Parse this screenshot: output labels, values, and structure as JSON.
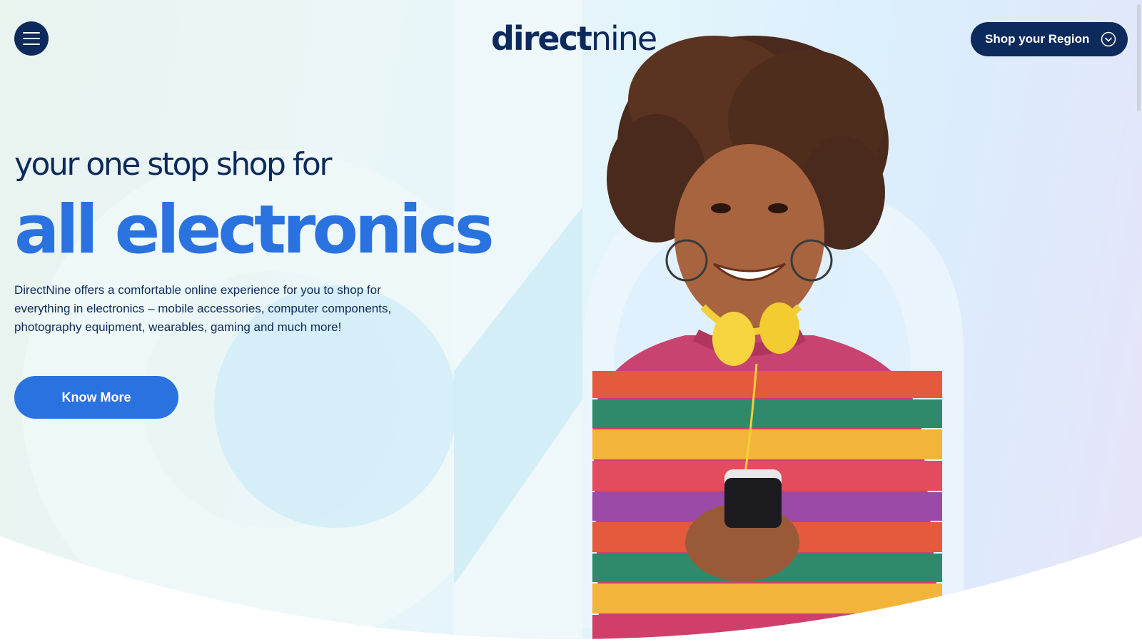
{
  "header": {
    "logo_bold": "direct",
    "logo_light": "nine",
    "region_button_label": "Shop your Region"
  },
  "hero": {
    "tagline": "your one stop shop for",
    "headline": "all electronics",
    "description": "DirectNine offers a comfortable online experience for you to shop for everything in electronics – mobile accessories, computer components, photography equipment, wearables, gaming and much more!",
    "cta_label": "Know More"
  },
  "colors": {
    "brand_navy": "#0d2a5c",
    "brand_blue": "#2a72e0"
  },
  "icons": {
    "menu": "hamburger-menu-icon",
    "region": "chevron-down-circle-icon"
  }
}
